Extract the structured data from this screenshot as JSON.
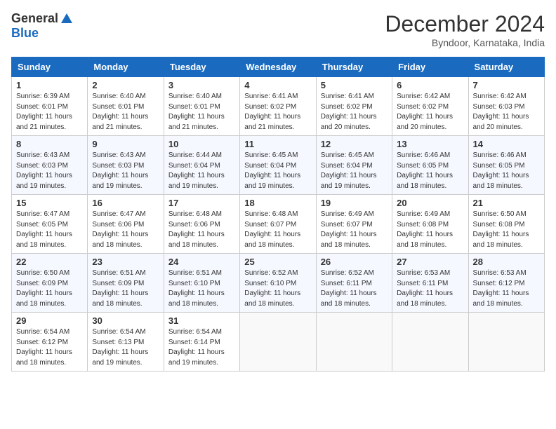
{
  "logo": {
    "general": "General",
    "blue": "Blue"
  },
  "title": "December 2024",
  "location": "Byndoor, Karnataka, India",
  "days_of_week": [
    "Sunday",
    "Monday",
    "Tuesday",
    "Wednesday",
    "Thursday",
    "Friday",
    "Saturday"
  ],
  "weeks": [
    [
      {
        "day": "1",
        "sunrise": "6:39 AM",
        "sunset": "6:01 PM",
        "daylight": "11 hours and 21 minutes."
      },
      {
        "day": "2",
        "sunrise": "6:40 AM",
        "sunset": "6:01 PM",
        "daylight": "11 hours and 21 minutes."
      },
      {
        "day": "3",
        "sunrise": "6:40 AM",
        "sunset": "6:01 PM",
        "daylight": "11 hours and 21 minutes."
      },
      {
        "day": "4",
        "sunrise": "6:41 AM",
        "sunset": "6:02 PM",
        "daylight": "11 hours and 21 minutes."
      },
      {
        "day": "5",
        "sunrise": "6:41 AM",
        "sunset": "6:02 PM",
        "daylight": "11 hours and 20 minutes."
      },
      {
        "day": "6",
        "sunrise": "6:42 AM",
        "sunset": "6:02 PM",
        "daylight": "11 hours and 20 minutes."
      },
      {
        "day": "7",
        "sunrise": "6:42 AM",
        "sunset": "6:03 PM",
        "daylight": "11 hours and 20 minutes."
      }
    ],
    [
      {
        "day": "8",
        "sunrise": "6:43 AM",
        "sunset": "6:03 PM",
        "daylight": "11 hours and 19 minutes."
      },
      {
        "day": "9",
        "sunrise": "6:43 AM",
        "sunset": "6:03 PM",
        "daylight": "11 hours and 19 minutes."
      },
      {
        "day": "10",
        "sunrise": "6:44 AM",
        "sunset": "6:04 PM",
        "daylight": "11 hours and 19 minutes."
      },
      {
        "day": "11",
        "sunrise": "6:45 AM",
        "sunset": "6:04 PM",
        "daylight": "11 hours and 19 minutes."
      },
      {
        "day": "12",
        "sunrise": "6:45 AM",
        "sunset": "6:04 PM",
        "daylight": "11 hours and 19 minutes."
      },
      {
        "day": "13",
        "sunrise": "6:46 AM",
        "sunset": "6:05 PM",
        "daylight": "11 hours and 18 minutes."
      },
      {
        "day": "14",
        "sunrise": "6:46 AM",
        "sunset": "6:05 PM",
        "daylight": "11 hours and 18 minutes."
      }
    ],
    [
      {
        "day": "15",
        "sunrise": "6:47 AM",
        "sunset": "6:05 PM",
        "daylight": "11 hours and 18 minutes."
      },
      {
        "day": "16",
        "sunrise": "6:47 AM",
        "sunset": "6:06 PM",
        "daylight": "11 hours and 18 minutes."
      },
      {
        "day": "17",
        "sunrise": "6:48 AM",
        "sunset": "6:06 PM",
        "daylight": "11 hours and 18 minutes."
      },
      {
        "day": "18",
        "sunrise": "6:48 AM",
        "sunset": "6:07 PM",
        "daylight": "11 hours and 18 minutes."
      },
      {
        "day": "19",
        "sunrise": "6:49 AM",
        "sunset": "6:07 PM",
        "daylight": "11 hours and 18 minutes."
      },
      {
        "day": "20",
        "sunrise": "6:49 AM",
        "sunset": "6:08 PM",
        "daylight": "11 hours and 18 minutes."
      },
      {
        "day": "21",
        "sunrise": "6:50 AM",
        "sunset": "6:08 PM",
        "daylight": "11 hours and 18 minutes."
      }
    ],
    [
      {
        "day": "22",
        "sunrise": "6:50 AM",
        "sunset": "6:09 PM",
        "daylight": "11 hours and 18 minutes."
      },
      {
        "day": "23",
        "sunrise": "6:51 AM",
        "sunset": "6:09 PM",
        "daylight": "11 hours and 18 minutes."
      },
      {
        "day": "24",
        "sunrise": "6:51 AM",
        "sunset": "6:10 PM",
        "daylight": "11 hours and 18 minutes."
      },
      {
        "day": "25",
        "sunrise": "6:52 AM",
        "sunset": "6:10 PM",
        "daylight": "11 hours and 18 minutes."
      },
      {
        "day": "26",
        "sunrise": "6:52 AM",
        "sunset": "6:11 PM",
        "daylight": "11 hours and 18 minutes."
      },
      {
        "day": "27",
        "sunrise": "6:53 AM",
        "sunset": "6:11 PM",
        "daylight": "11 hours and 18 minutes."
      },
      {
        "day": "28",
        "sunrise": "6:53 AM",
        "sunset": "6:12 PM",
        "daylight": "11 hours and 18 minutes."
      }
    ],
    [
      {
        "day": "29",
        "sunrise": "6:54 AM",
        "sunset": "6:12 PM",
        "daylight": "11 hours and 18 minutes."
      },
      {
        "day": "30",
        "sunrise": "6:54 AM",
        "sunset": "6:13 PM",
        "daylight": "11 hours and 19 minutes."
      },
      {
        "day": "31",
        "sunrise": "6:54 AM",
        "sunset": "6:14 PM",
        "daylight": "11 hours and 19 minutes."
      },
      null,
      null,
      null,
      null
    ]
  ]
}
